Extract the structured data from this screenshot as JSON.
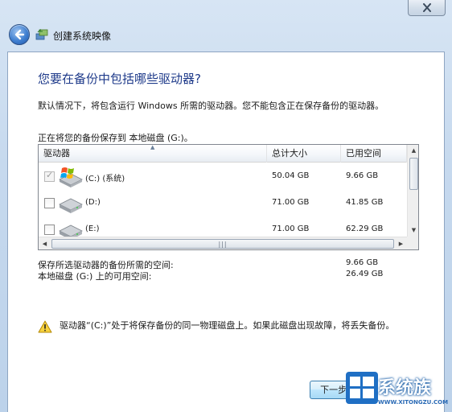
{
  "window": {
    "title": "创建系统映像",
    "close_symbol": "✕"
  },
  "page": {
    "heading": "您要在备份中包括哪些驱动器?",
    "description": "默认情况下，将包含运行 Windows 所需的驱动器。您不能包含正在保存备份的驱动器。",
    "saving_to": "正在将您的备份保存到 本地磁盘 (G:)。"
  },
  "drive_list": {
    "columns": [
      "驱动器",
      "总计大小",
      "已用空间"
    ],
    "rows": [
      {
        "name": "(C:) (系统)",
        "total": "50.04 GB",
        "used": "9.66 GB",
        "checked": true,
        "disabled": true,
        "icon": "windows-drive-icon"
      },
      {
        "name": "(D:)",
        "total": "71.00 GB",
        "used": "41.85 GB",
        "checked": false,
        "disabled": false,
        "icon": "hard-drive-icon"
      },
      {
        "name": "(E:)",
        "total": "71.00 GB",
        "used": "62.29 GB",
        "checked": false,
        "disabled": false,
        "icon": "hard-drive-icon"
      }
    ]
  },
  "summary": {
    "required_label": "保存所选驱动器的备份所需的空间:",
    "required_value": "9.66 GB",
    "available_label": "本地磁盘 (G:) 上的可用空间:",
    "available_value": "26.49 GB"
  },
  "warning": {
    "text": "驱动器“(C:)”处于将保存备份的同一物理磁盘上。如果此磁盘出现故障，将丢失备份。"
  },
  "buttons": {
    "next": "下一步(N)"
  },
  "watermark": {
    "brand": "系统族",
    "url": "WWW.XITONGZU.COM"
  },
  "colors": {
    "heading": "#1e3a8a",
    "frame": "#c6d9ee",
    "button_border": "#3c7fb1"
  }
}
